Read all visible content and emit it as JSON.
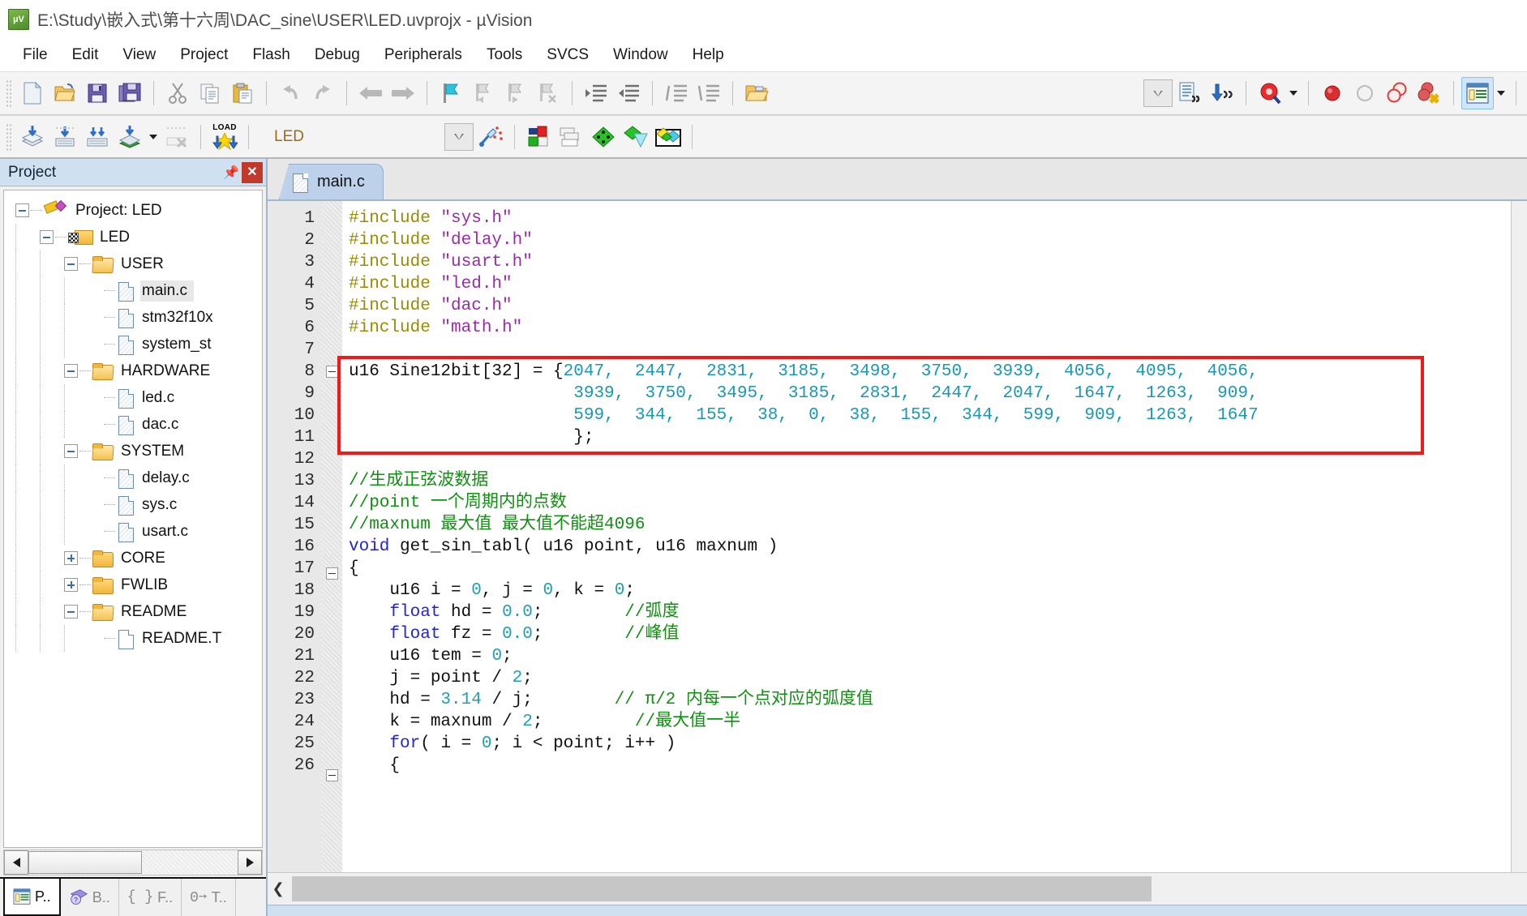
{
  "window": {
    "title": "E:\\Study\\嵌入式\\第十六周\\DAC_sine\\USER\\LED.uvprojx - µVision",
    "app_icon": "uvision-icon"
  },
  "menu": {
    "items": [
      {
        "label": "File"
      },
      {
        "label": "Edit"
      },
      {
        "label": "View"
      },
      {
        "label": "Project"
      },
      {
        "label": "Flash"
      },
      {
        "label": "Debug"
      },
      {
        "label": "Peripherals"
      },
      {
        "label": "Tools"
      },
      {
        "label": "SVCS"
      },
      {
        "label": "Window"
      },
      {
        "label": "Help"
      }
    ]
  },
  "toolbar1": {
    "buttons": [
      {
        "name": "new-file-icon",
        "tip": "New"
      },
      {
        "name": "open-file-icon",
        "tip": "Open"
      },
      {
        "name": "save-icon",
        "tip": "Save"
      },
      {
        "name": "save-all-icon",
        "tip": "Save All"
      },
      {
        "name": "cut-icon",
        "tip": "Cut"
      },
      {
        "name": "copy-icon",
        "tip": "Copy"
      },
      {
        "name": "paste-icon",
        "tip": "Paste"
      },
      {
        "name": "undo-icon",
        "tip": "Undo"
      },
      {
        "name": "redo-icon",
        "tip": "Redo"
      },
      {
        "name": "navigate-back-icon",
        "tip": "Back"
      },
      {
        "name": "navigate-forward-icon",
        "tip": "Forward"
      },
      {
        "name": "bookmark-toggle-icon",
        "tip": "Insert/Remove Bookmark"
      },
      {
        "name": "bookmark-prev-icon",
        "tip": "Previous Bookmark"
      },
      {
        "name": "bookmark-next-icon",
        "tip": "Next Bookmark"
      },
      {
        "name": "bookmark-clear-icon",
        "tip": "Clear All Bookmarks"
      },
      {
        "name": "indent-right-icon",
        "tip": "Indent"
      },
      {
        "name": "indent-left-icon",
        "tip": "Outdent"
      },
      {
        "name": "comment-icon",
        "tip": "Comment"
      },
      {
        "name": "uncomment-icon",
        "tip": "Uncomment"
      },
      {
        "name": "open-folder-icon",
        "tip": "Open Containing Folder"
      },
      {
        "name": "dropdown-box-icon",
        "tip": "Combo"
      },
      {
        "name": "find-in-files-icon",
        "tip": "Find in Files"
      },
      {
        "name": "incremental-find-icon",
        "tip": "Incremental Find"
      },
      {
        "name": "debug-session-icon",
        "tip": "Start/Stop Debug Session"
      },
      {
        "name": "breakpoint-insert-icon",
        "tip": "Insert/Remove Breakpoint"
      },
      {
        "name": "breakpoint-disable-icon",
        "tip": "Enable/Disable Breakpoint"
      },
      {
        "name": "breakpoint-disable-all-icon",
        "tip": "Disable All Breakpoints"
      },
      {
        "name": "breakpoint-kill-all-icon",
        "tip": "Kill All Breakpoints"
      },
      {
        "name": "project-window-icon",
        "tip": "Project Window"
      }
    ]
  },
  "toolbar2": {
    "buttons": [
      {
        "name": "translate-icon",
        "tip": "Translate Current File"
      },
      {
        "name": "build-icon",
        "tip": "Build"
      },
      {
        "name": "rebuild-icon",
        "tip": "Rebuild"
      },
      {
        "name": "batch-build-icon",
        "tip": "Batch Build"
      },
      {
        "name": "stop-build-icon",
        "tip": "Stop Build"
      },
      {
        "name": "download-icon",
        "tip": "Download",
        "label": "LOAD"
      },
      {
        "name": "target-options-icon",
        "tip": "Options for Target"
      },
      {
        "name": "manage-project-items-icon",
        "tip": "Manage Project Items"
      },
      {
        "name": "manage-rte-icon",
        "tip": "Manage Run-Time Environment"
      },
      {
        "name": "pack-installer-icon",
        "tip": "Pack Installer"
      },
      {
        "name": "select-software-packs-icon",
        "tip": "Select Software Packs"
      },
      {
        "name": "multi-project-icon",
        "tip": "Multi-Project"
      }
    ],
    "target_value": "LED"
  },
  "project_panel": {
    "title": "Project",
    "pin_icon": "pin-icon",
    "close_icon": "close-icon",
    "tree": [
      {
        "label": "Project: LED",
        "depth": 0,
        "icon": "project-icon",
        "expander": "minus",
        "selected": false
      },
      {
        "label": "LED",
        "depth": 1,
        "icon": "target-icon",
        "expander": "minus",
        "selected": false
      },
      {
        "label": "USER",
        "depth": 2,
        "icon": "folder-open-icon",
        "expander": "minus",
        "selected": false
      },
      {
        "label": "main.c",
        "depth": 3,
        "icon": "file-icon",
        "expander": "none",
        "selected": true
      },
      {
        "label": "stm32f10x",
        "depth": 3,
        "icon": "file-icon",
        "expander": "none",
        "selected": false
      },
      {
        "label": "system_st",
        "depth": 3,
        "icon": "file-icon",
        "expander": "none",
        "selected": false
      },
      {
        "label": "HARDWARE",
        "depth": 2,
        "icon": "folder-open-icon",
        "expander": "minus",
        "selected": false
      },
      {
        "label": "led.c",
        "depth": 3,
        "icon": "file-icon",
        "expander": "none",
        "selected": false
      },
      {
        "label": "dac.c",
        "depth": 3,
        "icon": "file-icon",
        "expander": "none",
        "selected": false
      },
      {
        "label": "SYSTEM",
        "depth": 2,
        "icon": "folder-open-icon",
        "expander": "minus",
        "selected": false
      },
      {
        "label": "delay.c",
        "depth": 3,
        "icon": "file-icon",
        "expander": "none",
        "selected": false
      },
      {
        "label": "sys.c",
        "depth": 3,
        "icon": "file-icon",
        "expander": "none",
        "selected": false
      },
      {
        "label": "usart.c",
        "depth": 3,
        "icon": "file-icon",
        "expander": "none",
        "selected": false
      },
      {
        "label": "CORE",
        "depth": 2,
        "icon": "folder-icon",
        "expander": "plus",
        "selected": false
      },
      {
        "label": "FWLIB",
        "depth": 2,
        "icon": "folder-icon",
        "expander": "plus",
        "selected": false
      },
      {
        "label": "README",
        "depth": 2,
        "icon": "folder-open-icon",
        "expander": "minus",
        "selected": false
      },
      {
        "label": "README.T",
        "depth": 3,
        "icon": "file-plain-icon",
        "expander": "none",
        "selected": false
      }
    ],
    "tabs": [
      {
        "label": "P..",
        "icon": "project-window-icon",
        "active": true
      },
      {
        "label": "B..",
        "icon": "books-icon",
        "active": false
      },
      {
        "label": "F..",
        "icon": "functions-icon",
        "active": false
      },
      {
        "label": "T..",
        "icon": "templates-icon",
        "active": false
      }
    ]
  },
  "editor": {
    "tabs": [
      {
        "label": "main.c",
        "icon": "file-icon",
        "active": true
      }
    ],
    "highlight_box_color": "#ef1b1b",
    "lines": [
      {
        "n": "1",
        "tokens": [
          {
            "t": "#include ",
            "c": "pp"
          },
          {
            "t": "\"sys.h\"",
            "c": "str"
          }
        ]
      },
      {
        "n": "2",
        "tokens": [
          {
            "t": "#include ",
            "c": "pp"
          },
          {
            "t": "\"delay.h\"",
            "c": "str"
          }
        ]
      },
      {
        "n": "3",
        "tokens": [
          {
            "t": "#include ",
            "c": "pp"
          },
          {
            "t": "\"usart.h\"",
            "c": "str"
          }
        ]
      },
      {
        "n": "4",
        "tokens": [
          {
            "t": "#include ",
            "c": "pp"
          },
          {
            "t": "\"led.h\"",
            "c": "str"
          }
        ]
      },
      {
        "n": "5",
        "tokens": [
          {
            "t": "#include ",
            "c": "pp"
          },
          {
            "t": "\"dac.h\"",
            "c": "str"
          }
        ]
      },
      {
        "n": "6",
        "tokens": [
          {
            "t": "#include ",
            "c": "pp"
          },
          {
            "t": "\"math.h\"",
            "c": "str"
          }
        ]
      },
      {
        "n": "7",
        "tokens": []
      },
      {
        "n": "8",
        "fold": "minus",
        "tokens": [
          {
            "t": "u16 Sine12bit[32] = {",
            "c": "txt"
          },
          {
            "t": "2047,  2447,  2831,  3185,  3498,  3750,  3939,  4056,  4095,  4056,",
            "c": "tealnum"
          }
        ]
      },
      {
        "n": "9",
        "tokens": [
          {
            "t": "                      ",
            "c": "txt"
          },
          {
            "t": "3939,  3750,  3495,  3185,  2831,  2447,  2047,  1647,  1263,  909,",
            "c": "tealnum"
          }
        ]
      },
      {
        "n": "10",
        "tokens": [
          {
            "t": "                      ",
            "c": "txt"
          },
          {
            "t": "599,  344,  155,  38,  0,  38,  155,  344,  599,  909,  1263,  1647",
            "c": "tealnum"
          }
        ]
      },
      {
        "n": "11",
        "tokens": [
          {
            "t": "                      };",
            "c": "txt"
          }
        ]
      },
      {
        "n": "12",
        "tokens": []
      },
      {
        "n": "13",
        "tokens": [
          {
            "t": "//生成正弦波数据",
            "c": "cmt"
          }
        ]
      },
      {
        "n": "14",
        "tokens": [
          {
            "t": "//point 一个周期内的点数",
            "c": "cmt"
          }
        ]
      },
      {
        "n": "15",
        "tokens": [
          {
            "t": "//maxnum 最大值 最大值不能超4096",
            "c": "cmt"
          }
        ]
      },
      {
        "n": "16",
        "tokens": [
          {
            "t": "void",
            "c": "kw"
          },
          {
            "t": " get_sin_tabl( u16 point, u16 maxnum )",
            "c": "txt"
          }
        ]
      },
      {
        "n": "17",
        "fold": "minus",
        "tokens": [
          {
            "t": "{",
            "c": "txt"
          }
        ]
      },
      {
        "n": "18",
        "tokens": [
          {
            "t": "    u16 i = ",
            "c": "txt"
          },
          {
            "t": "0",
            "c": "num"
          },
          {
            "t": ", j = ",
            "c": "txt"
          },
          {
            "t": "0",
            "c": "num"
          },
          {
            "t": ", k = ",
            "c": "txt"
          },
          {
            "t": "0",
            "c": "num"
          },
          {
            "t": ";",
            "c": "txt"
          }
        ]
      },
      {
        "n": "19",
        "tokens": [
          {
            "t": "    ",
            "c": "txt"
          },
          {
            "t": "float",
            "c": "kw"
          },
          {
            "t": " hd = ",
            "c": "txt"
          },
          {
            "t": "0.0",
            "c": "num"
          },
          {
            "t": ";        ",
            "c": "txt"
          },
          {
            "t": "//弧度",
            "c": "cmt"
          }
        ]
      },
      {
        "n": "20",
        "tokens": [
          {
            "t": "    ",
            "c": "txt"
          },
          {
            "t": "float",
            "c": "kw"
          },
          {
            "t": " fz = ",
            "c": "txt"
          },
          {
            "t": "0.0",
            "c": "num"
          },
          {
            "t": ";        ",
            "c": "txt"
          },
          {
            "t": "//峰值",
            "c": "cmt"
          }
        ]
      },
      {
        "n": "21",
        "tokens": [
          {
            "t": "    u16 tem = ",
            "c": "txt"
          },
          {
            "t": "0",
            "c": "num"
          },
          {
            "t": ";",
            "c": "txt"
          }
        ]
      },
      {
        "n": "22",
        "tokens": [
          {
            "t": "    j = point / ",
            "c": "txt"
          },
          {
            "t": "2",
            "c": "num"
          },
          {
            "t": ";",
            "c": "txt"
          }
        ]
      },
      {
        "n": "23",
        "tokens": [
          {
            "t": "    hd = ",
            "c": "txt"
          },
          {
            "t": "3.14",
            "c": "num"
          },
          {
            "t": " / j;        ",
            "c": "txt"
          },
          {
            "t": "// π/2 内每一个点对应的弧度值",
            "c": "cmt"
          }
        ]
      },
      {
        "n": "24",
        "tokens": [
          {
            "t": "    k = maxnum / ",
            "c": "txt"
          },
          {
            "t": "2",
            "c": "num"
          },
          {
            "t": ";         ",
            "c": "txt"
          },
          {
            "t": "//最大值一半",
            "c": "cmt"
          }
        ]
      },
      {
        "n": "25",
        "tokens": [
          {
            "t": "    ",
            "c": "txt"
          },
          {
            "t": "for",
            "c": "kw"
          },
          {
            "t": "( i = ",
            "c": "txt"
          },
          {
            "t": "0",
            "c": "num"
          },
          {
            "t": "; i < point; i++ )",
            "c": "txt"
          }
        ]
      },
      {
        "n": "26",
        "fold": "minus",
        "tokens": [
          {
            "t": "    {",
            "c": "txt"
          }
        ]
      }
    ],
    "scrollbar_left_icon": "chevron-left-icon"
  }
}
